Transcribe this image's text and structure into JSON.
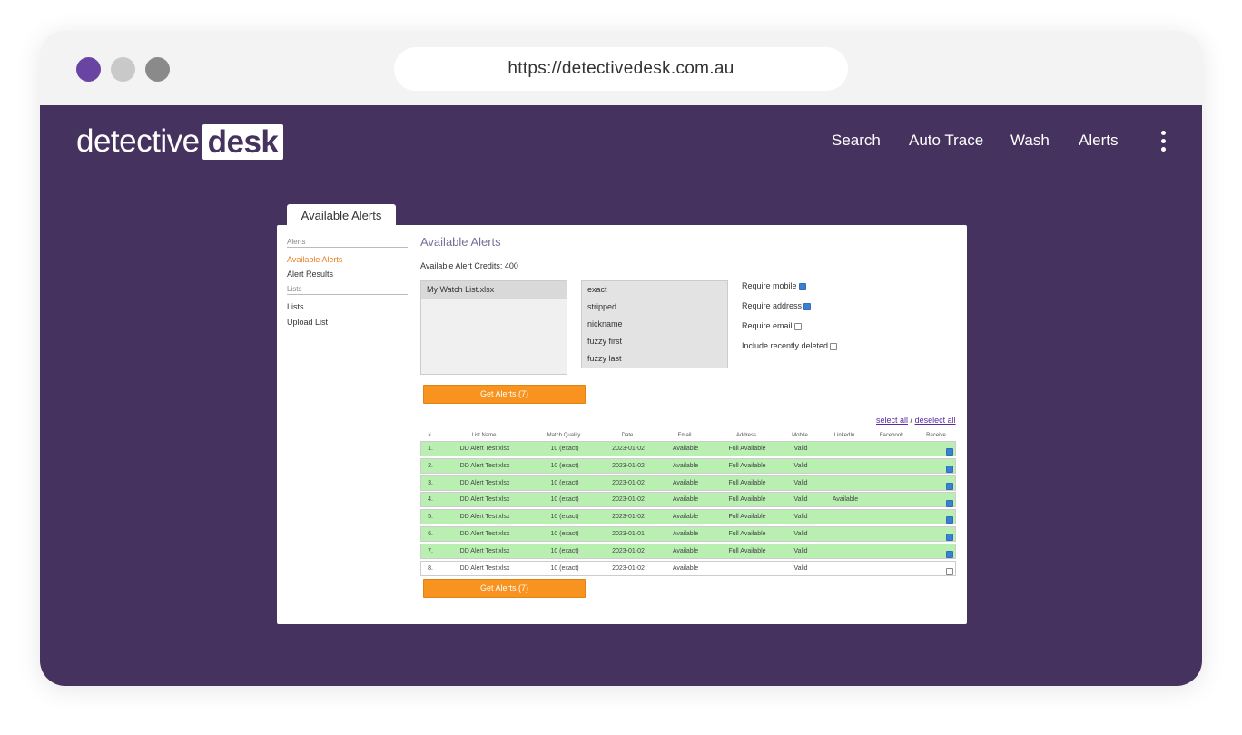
{
  "browser": {
    "url": "https://detectivedesk.com.au"
  },
  "site": {
    "logo_light": "detective",
    "logo_box": "desk",
    "nav": [
      "Search",
      "Auto Trace",
      "Wash",
      "Alerts"
    ]
  },
  "app": {
    "tab_label": "Available Alerts",
    "sidebar": {
      "alerts_heading": "Alerts",
      "available_alerts": "Available Alerts",
      "alert_results": "Alert Results",
      "lists_heading": "Lists",
      "lists": "Lists",
      "upload_list": "Upload List"
    },
    "title": "Available Alerts",
    "credits": "Available Alert Credits: 400",
    "watch_lists": [
      "My Watch List.xlsx"
    ],
    "match_options": [
      "exact",
      "stripped",
      "nickname",
      "fuzzy first",
      "fuzzy last"
    ],
    "options": [
      {
        "label": "Require mobile",
        "checked": true
      },
      {
        "label": "Require address",
        "checked": true
      },
      {
        "label": "Require email",
        "checked": false
      },
      {
        "label": "Include recently deleted",
        "checked": false
      }
    ],
    "get_alerts_label": "Get Alerts (7)",
    "select_all": "select all",
    "separator": "/",
    "deselect_all": "deselect all",
    "columns": [
      "#",
      "List Name",
      "Match Quality",
      "Date",
      "Email",
      "Address",
      "Mobile",
      "LinkedIn",
      "Facebook",
      "Receive"
    ],
    "rows": [
      {
        "num": "1.",
        "list": "DD Alert Test.xlsx",
        "quality": "10 (exact)",
        "date": "2023-01-02",
        "email": "Available",
        "address": "Full Available",
        "mobile": "Valid",
        "linkedin": "",
        "facebook": "",
        "receive": true
      },
      {
        "num": "2.",
        "list": "DD Alert Test.xlsx",
        "quality": "10 (exact)",
        "date": "2023-01-02",
        "email": "Available",
        "address": "Full Available",
        "mobile": "Valid",
        "linkedin": "",
        "facebook": "",
        "receive": true
      },
      {
        "num": "3.",
        "list": "DD Alert Test.xlsx",
        "quality": "10 (exact)",
        "date": "2023-01-02",
        "email": "Available",
        "address": "Full Available",
        "mobile": "Valid",
        "linkedin": "",
        "facebook": "",
        "receive": true
      },
      {
        "num": "4.",
        "list": "DD Alert Test.xlsx",
        "quality": "10 (exact)",
        "date": "2023-01-02",
        "email": "Available",
        "address": "Full Available",
        "mobile": "Valid",
        "linkedin": "Available",
        "facebook": "",
        "receive": true
      },
      {
        "num": "5.",
        "list": "DD Alert Test.xlsx",
        "quality": "10 (exact)",
        "date": "2023-01-02",
        "email": "Available",
        "address": "Full Available",
        "mobile": "Valid",
        "linkedin": "",
        "facebook": "",
        "receive": true
      },
      {
        "num": "6.",
        "list": "DD Alert Test.xlsx",
        "quality": "10 (exact)",
        "date": "2023-01-01",
        "email": "Available",
        "address": "Full Available",
        "mobile": "Valid",
        "linkedin": "",
        "facebook": "",
        "receive": true
      },
      {
        "num": "7.",
        "list": "DD Alert Test.xlsx",
        "quality": "10 (exact)",
        "date": "2023-01-02",
        "email": "Available",
        "address": "Full Available",
        "mobile": "Valid",
        "linkedin": "",
        "facebook": "",
        "receive": true
      },
      {
        "num": "8.",
        "list": "DD Alert Test.xlsx",
        "quality": "10 (exact)",
        "date": "2023-01-02",
        "email": "Available",
        "address": "",
        "mobile": "Valid",
        "linkedin": "",
        "facebook": "",
        "receive": false
      }
    ],
    "colors": {
      "site_bg": "#46325e",
      "accent_orange": "#f7931e",
      "row_green": "#b9f0b2",
      "link_purple": "#5a2aa0"
    }
  }
}
